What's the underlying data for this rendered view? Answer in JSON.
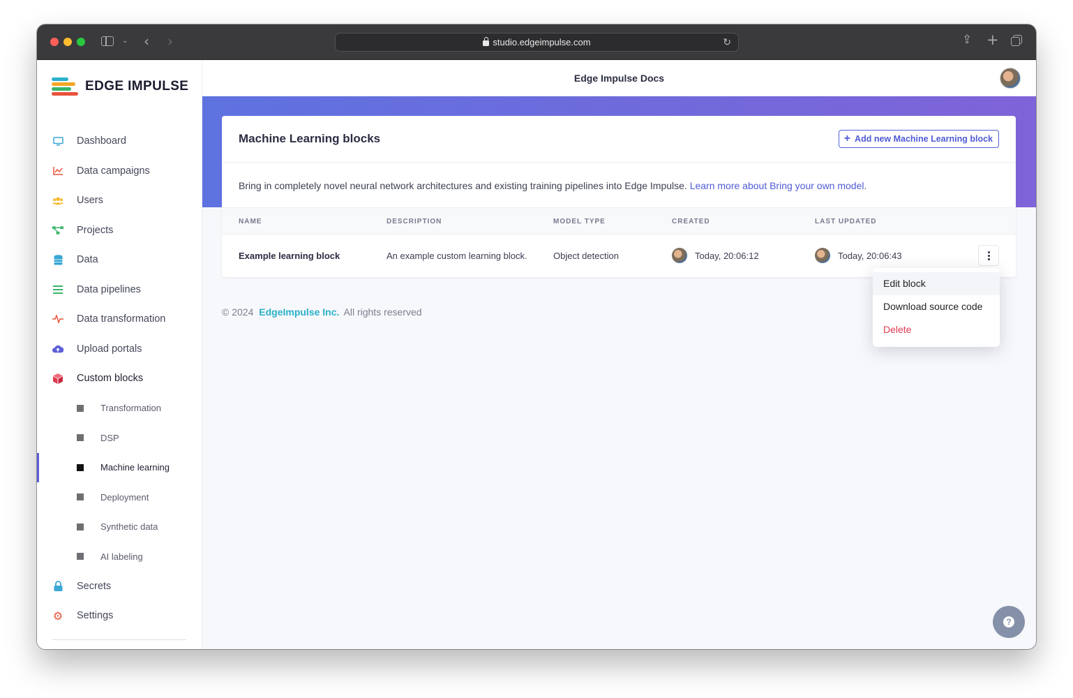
{
  "browser": {
    "url": "studio.edgeimpulse.com",
    "icons": [
      "sidebar-toggle-icon",
      "chevron-down-icon",
      "back-icon",
      "forward-icon",
      "lock-icon",
      "reload-icon",
      "share-icon",
      "new-tab-icon",
      "tabs-overview-icon"
    ]
  },
  "brand": {
    "name": "EDGE IMPULSE",
    "colors": [
      "#2bb0c9",
      "#f5a623",
      "#3ab56a",
      "#e8533b"
    ]
  },
  "sidebar": {
    "items": [
      {
        "label": "Dashboard",
        "icon": "monitor-icon",
        "color": "#3aa7d6"
      },
      {
        "label": "Data campaigns",
        "icon": "chart-icon",
        "color": "#e8533b"
      },
      {
        "label": "Users",
        "icon": "users-icon",
        "color": "#f5b823"
      },
      {
        "label": "Projects",
        "icon": "projects-icon",
        "color": "#3ab56a"
      },
      {
        "label": "Data",
        "icon": "database-icon",
        "color": "#3aa7d6"
      },
      {
        "label": "Data pipelines",
        "icon": "pipeline-icon",
        "color": "#3ab56a"
      },
      {
        "label": "Data transformation",
        "icon": "pulse-icon",
        "color": "#e8533b"
      },
      {
        "label": "Upload portals",
        "icon": "cloud-upload-icon",
        "color": "#5c5fd6"
      },
      {
        "label": "Custom blocks",
        "icon": "cube-icon",
        "color": "#e03a4e"
      }
    ],
    "sub_items": [
      {
        "label": "Transformation"
      },
      {
        "label": "DSP"
      },
      {
        "label": "Machine learning",
        "active": true
      },
      {
        "label": "Deployment"
      },
      {
        "label": "Synthetic data"
      },
      {
        "label": "AI labeling"
      }
    ],
    "bottom_items": [
      {
        "label": "Secrets",
        "icon": "lock-icon",
        "color": "#3aa7d6"
      },
      {
        "label": "Settings",
        "icon": "gear-icon",
        "color": "#e8533b"
      }
    ]
  },
  "topbar": {
    "docs_label": "Edge Impulse Docs"
  },
  "card": {
    "title": "Machine Learning blocks",
    "add_button": "Add new Machine Learning block",
    "description": "Bring in completely novel neural network architectures and existing training pipelines into Edge Impulse.",
    "learn_more": "Learn more about Bring your own model",
    "columns": [
      "NAME",
      "DESCRIPTION",
      "MODEL TYPE",
      "CREATED",
      "LAST UPDATED"
    ],
    "rows": [
      {
        "name": "Example learning block",
        "description": "An example custom learning block.",
        "model_type": "Object detection",
        "created": "Today, 20:06:12",
        "last_updated": "Today, 20:06:43"
      }
    ]
  },
  "menu": {
    "items": [
      {
        "label": "Edit block"
      },
      {
        "label": "Download source code"
      },
      {
        "label": "Delete",
        "danger": true
      }
    ]
  },
  "footer": {
    "copyright": "© 2024",
    "company": "EdgeImpulse Inc.",
    "rights": "All rights reserved"
  }
}
